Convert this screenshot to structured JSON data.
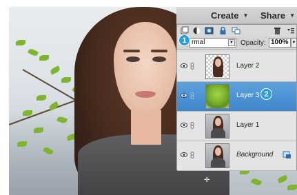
{
  "menubar": {
    "create_label": "Create",
    "share_label": "Share"
  },
  "layers_panel": {
    "blend_mode_value": "rmal",
    "opacity_label": "Opacity:",
    "opacity_value": "100%",
    "layers": [
      {
        "name": "Layer 2",
        "selected": false,
        "thumbnail": "portrait-cutout-transparent"
      },
      {
        "name": "Layer 3",
        "selected": true,
        "thumbnail": "tree-foliage"
      },
      {
        "name": "Layer 1",
        "selected": false,
        "thumbnail": "portrait"
      },
      {
        "name": "Background",
        "selected": false,
        "thumbnail": "portrait",
        "italic": true
      }
    ]
  },
  "callouts": {
    "step1": "1",
    "step2": "2"
  },
  "colors": {
    "selection_blue": "#4a92d4",
    "callout_blue": "#2a9fd8"
  },
  "icons": [
    "new-layer-icon",
    "adjustment-layer-icon",
    "mask-icon",
    "lock-icon",
    "link-layers-icon",
    "trash-icon",
    "panel-menu-icon",
    "eye-icon",
    "chain-icon",
    "photo-badge-icon"
  ]
}
